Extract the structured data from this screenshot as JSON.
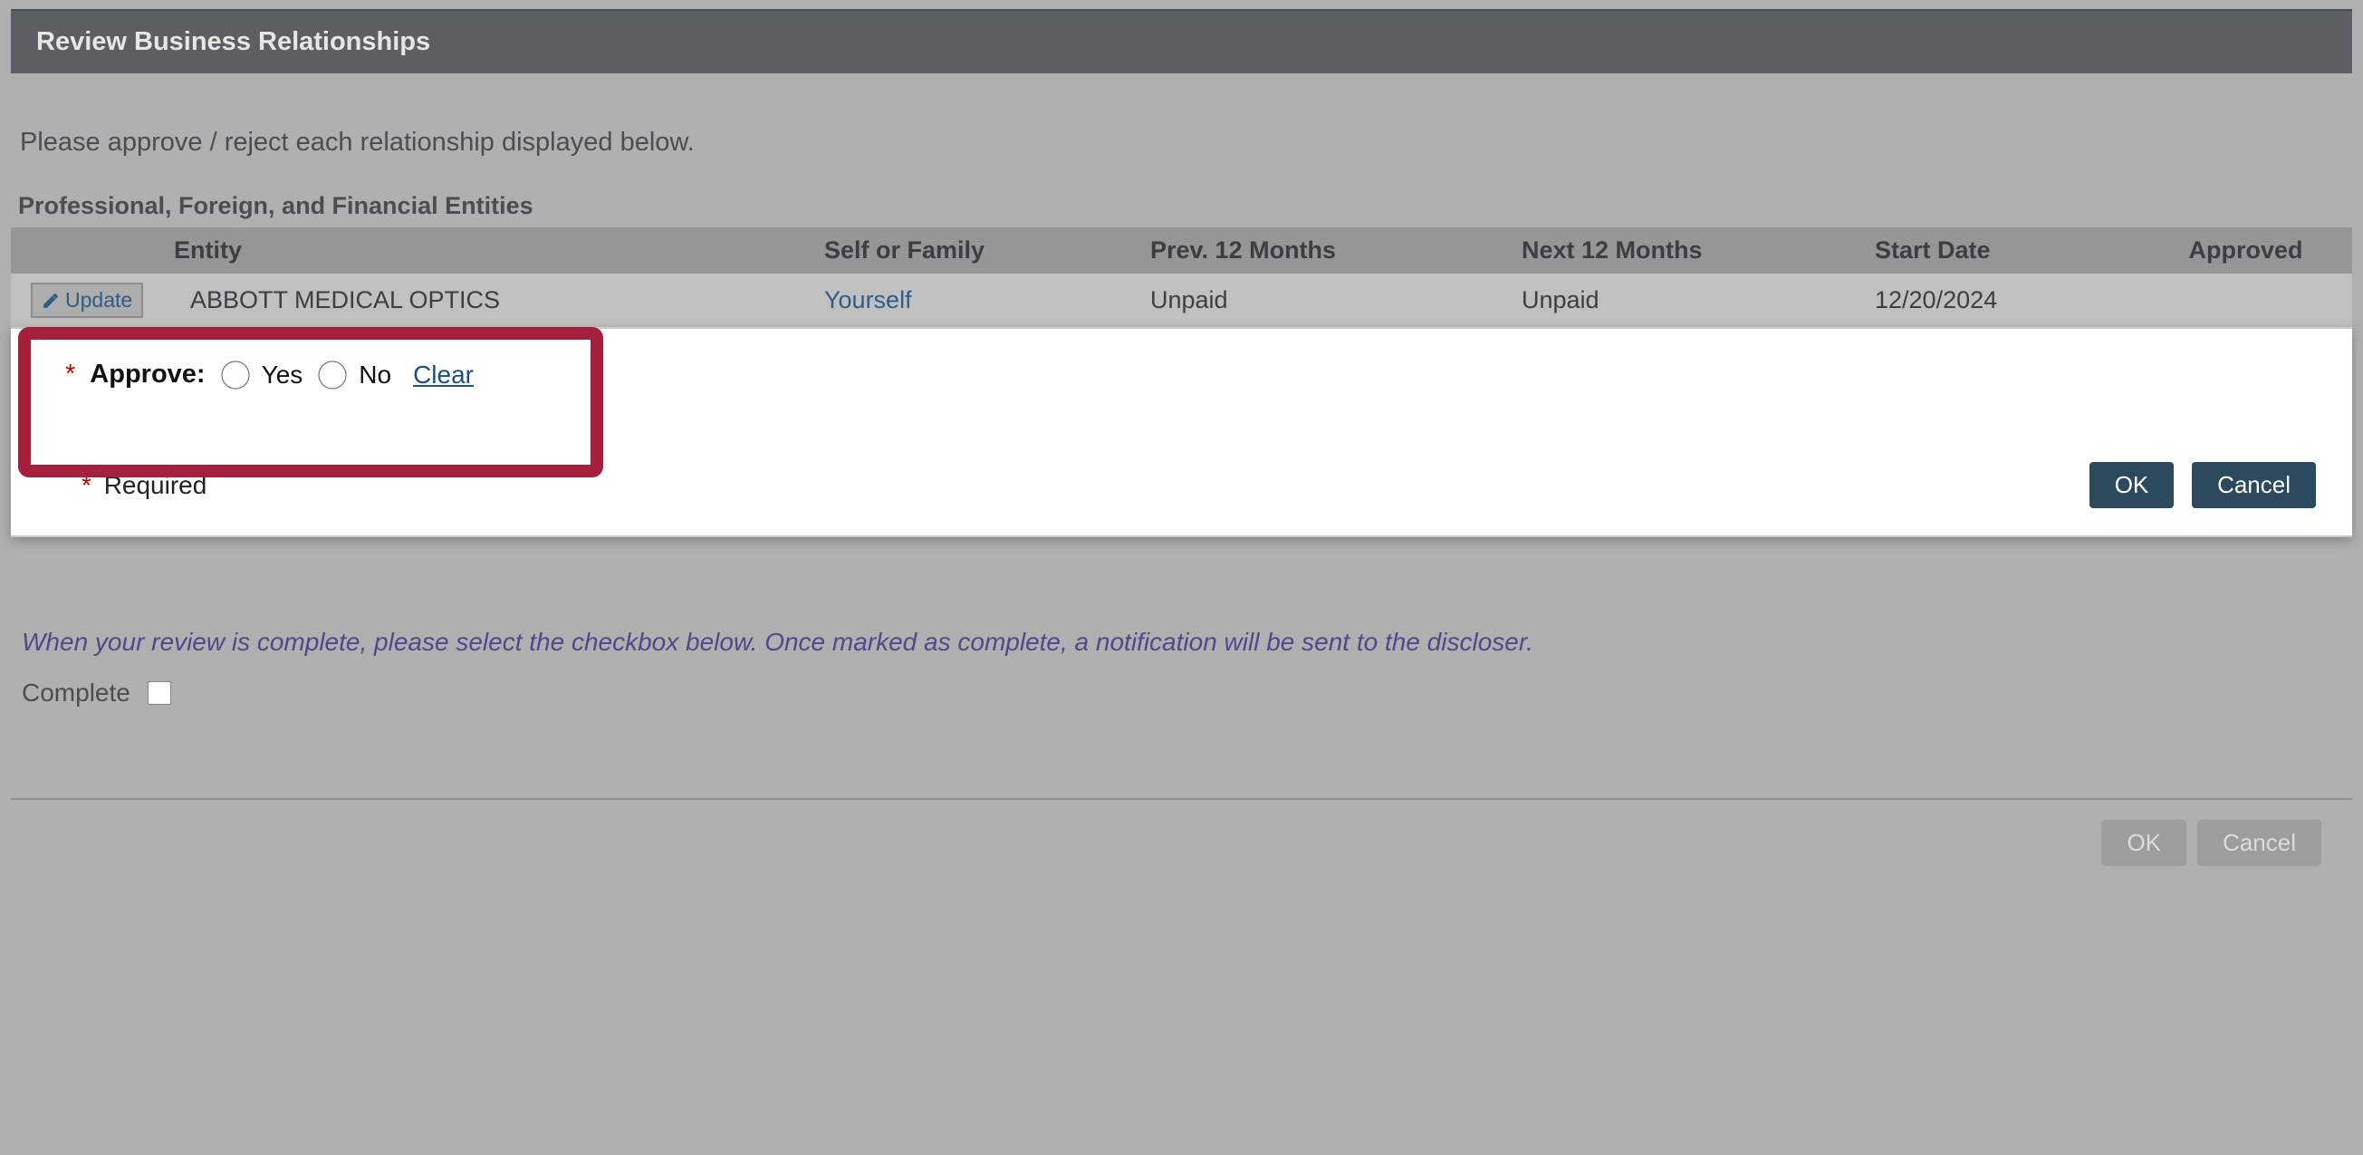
{
  "header": {
    "title": "Review Business Relationships"
  },
  "instruction": "Please approve / reject each relationship displayed below.",
  "section_title": "Professional, Foreign, and Financial Entities",
  "columns": {
    "entity": "Entity",
    "self": "Self or Family",
    "prev": "Prev. 12 Months",
    "next": "Next 12 Months",
    "start": "Start Date",
    "approved": "Approved"
  },
  "rows": [
    {
      "update_label": "Update",
      "entity": "ABBOTT MEDICAL OPTICS",
      "self": "Yourself",
      "prev": "Unpaid",
      "next": "Unpaid",
      "start": "12/20/2024",
      "approved": ""
    }
  ],
  "approve": {
    "asterisk": "*",
    "label": "Approve:",
    "yes": "Yes",
    "no": "No",
    "clear": "Clear"
  },
  "required_note": {
    "asterisk": "*",
    "text": "Required"
  },
  "buttons": {
    "ok": "OK",
    "cancel": "Cancel"
  },
  "review_note": "When your review is complete, please select the checkbox below. Once marked as complete, a notification will be sent to the discloser.",
  "complete": {
    "label": "Complete"
  }
}
